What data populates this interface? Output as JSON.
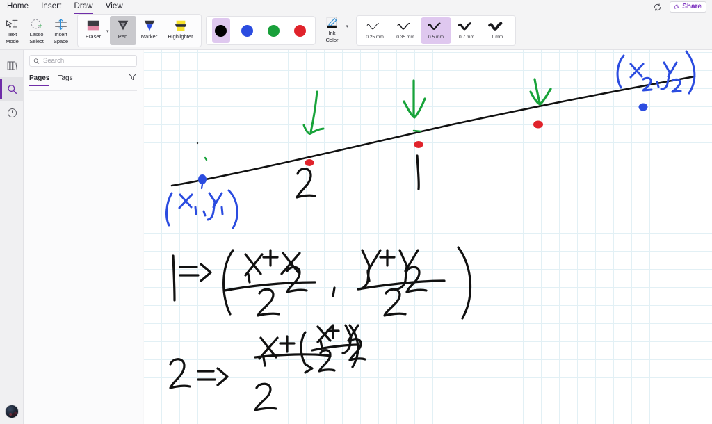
{
  "menubar": {
    "items": [
      {
        "label": "Home",
        "active": false
      },
      {
        "label": "Insert",
        "active": false
      },
      {
        "label": "Draw",
        "active": true
      },
      {
        "label": "View",
        "active": false
      }
    ],
    "sync_icon": "sync-icon",
    "share_label": "Share",
    "share_icon": "share-icon",
    "accent_color": "#6f2da8"
  },
  "ribbon": {
    "mode_tools": [
      {
        "label_line1": "Text",
        "label_line2": "Mode",
        "icon": "text-cursor-icon",
        "selected": false
      },
      {
        "label_line1": "Lasso",
        "label_line2": "Select",
        "icon": "lasso-select-icon",
        "selected": false
      },
      {
        "label_line1": "Insert",
        "label_line2": "Space",
        "icon": "insert-space-icon",
        "selected": false
      }
    ],
    "pen_tools": [
      {
        "label": "Eraser",
        "icon": "eraser-icon",
        "selected": false
      },
      {
        "label": "Pen",
        "icon": "pen-icon",
        "selected": true
      },
      {
        "label": "Marker",
        "icon": "marker-icon",
        "selected": false
      },
      {
        "label": "Highlighter",
        "icon": "highlighter-icon",
        "selected": false
      }
    ],
    "colors": [
      {
        "name": "black",
        "hex": "#000000",
        "selected": true
      },
      {
        "name": "blue",
        "hex": "#2b4ce0",
        "selected": false
      },
      {
        "name": "green",
        "hex": "#19a03a",
        "selected": false
      },
      {
        "name": "red",
        "hex": "#e0232b",
        "selected": false
      }
    ],
    "ink_color": {
      "label_line1": "Ink",
      "label_line2": "Color",
      "icon": "ink-color-pencil-icon"
    },
    "widths": [
      {
        "label": "0.25 mm",
        "stroke": 1.1,
        "selected": false
      },
      {
        "label": "0.35 mm",
        "stroke": 1.7,
        "selected": false
      },
      {
        "label": "0.5 mm",
        "stroke": 2.6,
        "selected": true
      },
      {
        "label": "0.7 mm",
        "stroke": 3.4,
        "selected": false
      },
      {
        "label": "1 mm",
        "stroke": 4.4,
        "selected": false
      }
    ]
  },
  "rail": {
    "items": [
      {
        "name": "library-icon",
        "active": false
      },
      {
        "name": "search-icon",
        "active": true
      },
      {
        "name": "history-clock-icon",
        "active": false
      }
    ],
    "avatar": "user-avatar"
  },
  "panel": {
    "search_placeholder": "Search",
    "search_value": "",
    "search_icon": "search-icon",
    "tabs": [
      {
        "label": "Pages",
        "active": true
      },
      {
        "label": "Tags",
        "active": false
      }
    ],
    "filter_icon": "filter-funnel-icon"
  },
  "canvas": {
    "grid": "blue-graph-grid",
    "grid_color": "#e2f0f5",
    "grid_size": 26,
    "ink_colors": {
      "black": "#111111",
      "blue": "#2b4ce0",
      "green": "#18a33a",
      "red": "#e0232b"
    },
    "annotations": [
      {
        "name": "segment-line",
        "color": "black",
        "text": ""
      },
      {
        "name": "endpoint-1-label",
        "color": "blue",
        "text": "(x1, y1)"
      },
      {
        "name": "endpoint-2-label",
        "color": "blue",
        "text": "(x2, y2)"
      },
      {
        "name": "midpoint-label-2",
        "color": "black",
        "text": "2"
      },
      {
        "name": "midpoint-label-1",
        "color": "black",
        "text": "1"
      },
      {
        "name": "formula-1",
        "color": "black",
        "text": "1 => ( (x1 + x2)/2 , (y1 + y2)/2 )"
      },
      {
        "name": "formula-2",
        "color": "black",
        "text": "2 => ( x1 + ((x1 + y2)/2) ) / 2"
      },
      {
        "name": "green-arrow-left",
        "color": "green",
        "text": ""
      },
      {
        "name": "green-arrow-middle",
        "color": "green",
        "text": ""
      },
      {
        "name": "green-arrow-right",
        "color": "green",
        "text": ""
      }
    ]
  }
}
